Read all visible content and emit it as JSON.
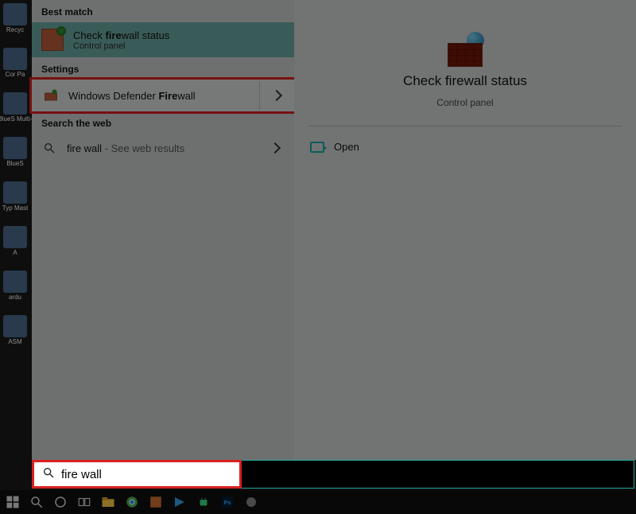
{
  "desktop": {
    "icons": [
      "Recyc",
      "",
      "Cor\nPa",
      "",
      "BlueS\nMulti-",
      "",
      "BlueS",
      "",
      "Typ\nMast",
      "",
      "A",
      "",
      "ardu",
      "",
      "ASM"
    ]
  },
  "start": {
    "sections": {
      "best_match": "Best match",
      "settings": "Settings",
      "search_web": "Search the web"
    },
    "best_match_item": {
      "title_pre": "Check ",
      "title_bold": "fire",
      "title_post": "wall status",
      "subtitle": "Control panel"
    },
    "settings_item": {
      "label_pre": "Windows Defender ",
      "label_bold": "Fire",
      "label_post": "wall"
    },
    "web_item": {
      "label": "fire wall",
      "hint": " - See web results"
    }
  },
  "detail": {
    "title": "Check firewall status",
    "subtitle": "Control panel",
    "open_label": "Open"
  },
  "search": {
    "value": "fire wall"
  },
  "taskbar": {
    "items": [
      "start",
      "search",
      "cortana",
      "taskview",
      "explorer",
      "chrome",
      "app1",
      "vscode",
      "android",
      "photoshop",
      "app2"
    ]
  }
}
